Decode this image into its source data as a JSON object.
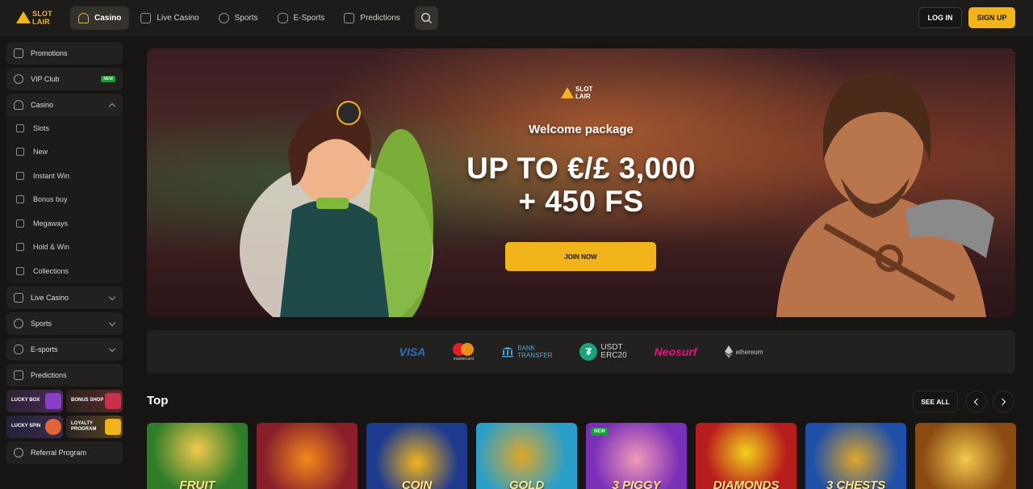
{
  "brand": {
    "logo_line1": "SLOT",
    "logo_line2": "LAIR",
    "accent": "#f2b41b"
  },
  "nav": {
    "items": [
      {
        "label": "Casino",
        "icon": "casino-icon",
        "active": true
      },
      {
        "label": "Live Casino",
        "icon": "live-casino-icon"
      },
      {
        "label": "Sports",
        "icon": "sports-icon"
      },
      {
        "label": "E-Sports",
        "icon": "esports-icon"
      },
      {
        "label": "Predictions",
        "icon": "predictions-icon"
      }
    ],
    "search_icon": "search-icon",
    "login": "LOG IN",
    "signup": "SIGN UP"
  },
  "sidebar": {
    "promotions": "Promotions",
    "vip": "VIP Club",
    "vip_badge": "NEW",
    "casino": "Casino",
    "casino_sub": [
      "Slots",
      "New",
      "Instant Win",
      "Bonus buy",
      "Megaways",
      "Hold & Win",
      "Collections"
    ],
    "live_casino": "Live Casino",
    "sports": "Sports",
    "esports": "E-sports",
    "predictions": "Predictions",
    "tiles": [
      "LUCKY BOX",
      "BONUS SHOP",
      "LUCKY SPIN",
      "LOYALTY PROGRAM"
    ],
    "referral": "Referral Program"
  },
  "hero": {
    "logo_line1": "SLOT",
    "logo_line2": "LAIR",
    "subtitle": "Welcome package",
    "headline_1": "UP TO €/£ 3,000",
    "headline_2": "+ 450 FS",
    "cta": "JOIN NOW"
  },
  "payments": {
    "visa": "VISA",
    "mastercard": "mastercard",
    "bank_1": "BANK",
    "bank_2": "TRANSFER",
    "usdt_1": "USDT",
    "usdt_2": "ERC20",
    "neosurf": "Neosurf",
    "ethereum": "ethereum"
  },
  "top": {
    "title": "Top",
    "see_all": "SEE ALL",
    "games": [
      {
        "title": "FRUIT",
        "bg": "#2f7d2a"
      },
      {
        "title": "",
        "bg": "#8a1f2a"
      },
      {
        "title": "COIN",
        "bg": "#1d3a8f"
      },
      {
        "title": "GOLD",
        "bg": "#2a9fc9"
      },
      {
        "title": "3 PIGGY",
        "bg": "#7a2fb8",
        "badge": "NEW"
      },
      {
        "title": "DIAMONDS",
        "bg": "#b81d1d"
      },
      {
        "title": "3 CHESTS",
        "bg": "#1f4fa8"
      },
      {
        "title": "",
        "bg": "#8a4a12"
      }
    ]
  }
}
